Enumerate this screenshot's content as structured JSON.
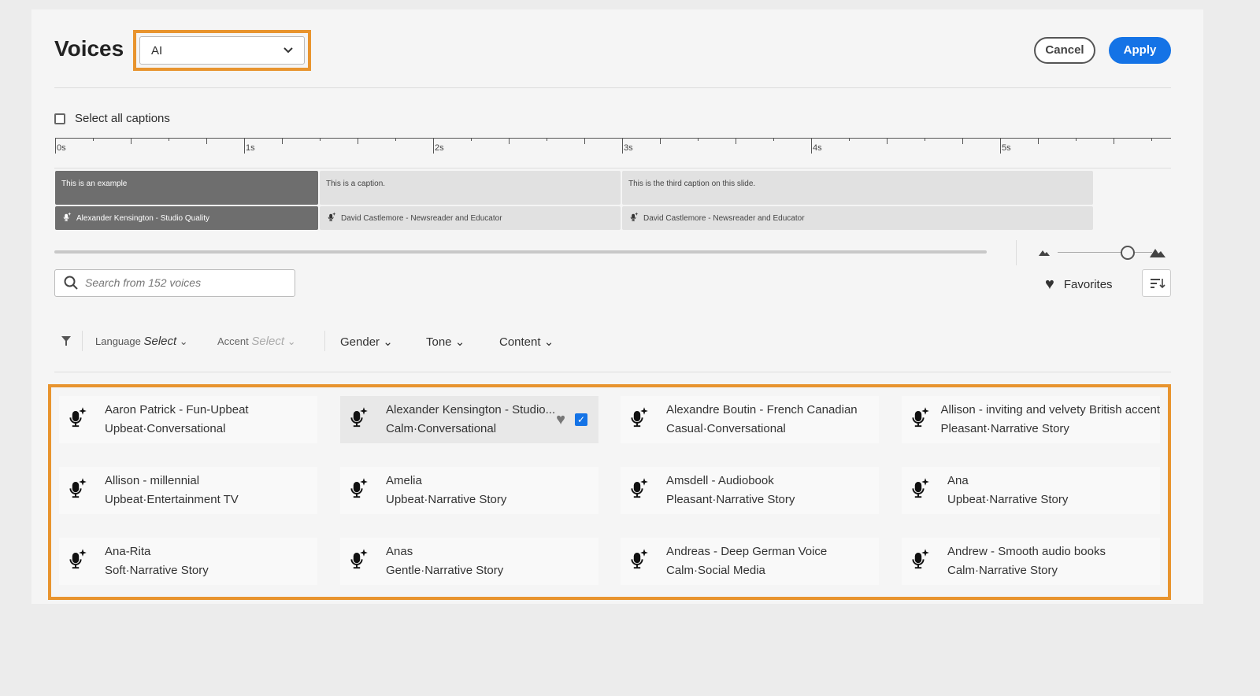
{
  "header": {
    "title": "Voices",
    "voice_type": "AI",
    "cancel": "Cancel",
    "apply": "Apply"
  },
  "select_all": "Select all captions",
  "timeline": {
    "labels": [
      "0s",
      "1s",
      "2s",
      "3s",
      "4s",
      "5s"
    ]
  },
  "captions": [
    {
      "text": "This is an example",
      "voice": "Alexander Kensington - Studio Quality",
      "selected": true
    },
    {
      "text": "This is a caption.",
      "voice": "David Castlemore - Newsreader and Educator",
      "selected": false
    },
    {
      "text": "This is the third caption on this slide.",
      "voice": "David Castlemore - Newsreader and Educator",
      "selected": false
    }
  ],
  "search": {
    "placeholder": "Search from 152 voices"
  },
  "favorites": "Favorites",
  "filters": {
    "language_label": "Language",
    "language_value": "Select",
    "accent_label": "Accent",
    "accent_value": "Select",
    "gender": "Gender",
    "tone": "Tone",
    "content": "Content"
  },
  "voices": [
    {
      "name": "Aaron Patrick - Fun-Upbeat",
      "desc": "Upbeat·Conversational"
    },
    {
      "name": "Alexander Kensington - Studio...",
      "desc": "Calm·Conversational",
      "selected": true
    },
    {
      "name": "Alexandre Boutin - French Canadian",
      "desc": "Casual·Conversational"
    },
    {
      "name": "Allison - inviting and velvety British accent",
      "desc": "Pleasant·Narrative Story"
    },
    {
      "name": "Allison - millennial",
      "desc": "Upbeat·Entertainment TV"
    },
    {
      "name": "Amelia",
      "desc": "Upbeat·Narrative Story"
    },
    {
      "name": "Amsdell - Audiobook",
      "desc": "Pleasant·Narrative Story"
    },
    {
      "name": "Ana",
      "desc": "Upbeat·Narrative Story"
    },
    {
      "name": "Ana-Rita",
      "desc": "Soft·Narrative Story"
    },
    {
      "name": "Anas",
      "desc": "Gentle·Narrative Story"
    },
    {
      "name": "Andreas - Deep German Voice",
      "desc": "Calm·Social Media"
    },
    {
      "name": "Andrew - Smooth audio books",
      "desc": "Calm·Narrative Story"
    }
  ],
  "colors": {
    "accent": "#1473e6",
    "highlight": "#e8942e"
  }
}
